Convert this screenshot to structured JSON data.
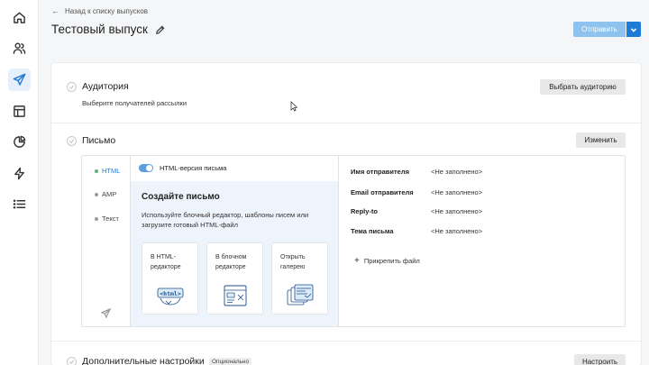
{
  "nav": {
    "back_label": "Назад к списку выпусков",
    "items": [
      "home",
      "users",
      "campaigns",
      "templates",
      "analytics",
      "automation",
      "lists"
    ]
  },
  "header": {
    "title": "Тестовый выпуск",
    "send_label": "Отправить"
  },
  "audience": {
    "title": "Аудитория",
    "subtitle": "Выберите получателей рассылки",
    "button_label": "Выбрать аудиторию"
  },
  "letter": {
    "title": "Письмо",
    "button_label": "Изменить",
    "tabs": [
      {
        "label": "HTML"
      },
      {
        "label": "AMP"
      },
      {
        "label": "Текст"
      }
    ],
    "toggle_label": "HTML-версия письма",
    "create_title": "Создайте письмо",
    "create_desc": "Используйте блочный редактор, шаблоны писем или загрузите готовый HTML-файл",
    "options": [
      {
        "label": "В HTML-редакторе"
      },
      {
        "label": "В блочном редакторе"
      },
      {
        "label": "Открыть галерею"
      }
    ],
    "fields": [
      {
        "key": "Имя отправителя",
        "value": "<Не заполнено>"
      },
      {
        "key": "Email отправителя",
        "value": "<Не заполнено>"
      },
      {
        "key": "Reply-to",
        "value": "<Не заполнено>"
      },
      {
        "key": "Тема письма",
        "value": "<Не заполнено>"
      }
    ],
    "attach_label": "Прикрепить файл",
    "html_icon_text": "<html>"
  },
  "extra": {
    "title": "Дополнительные настройки",
    "badge": "Опционально",
    "button_label": "Настроить"
  },
  "colors": {
    "accent": "#1e7bd6",
    "send_disabled": "#8fc3ef",
    "panel_bg": "#eef4fb"
  }
}
